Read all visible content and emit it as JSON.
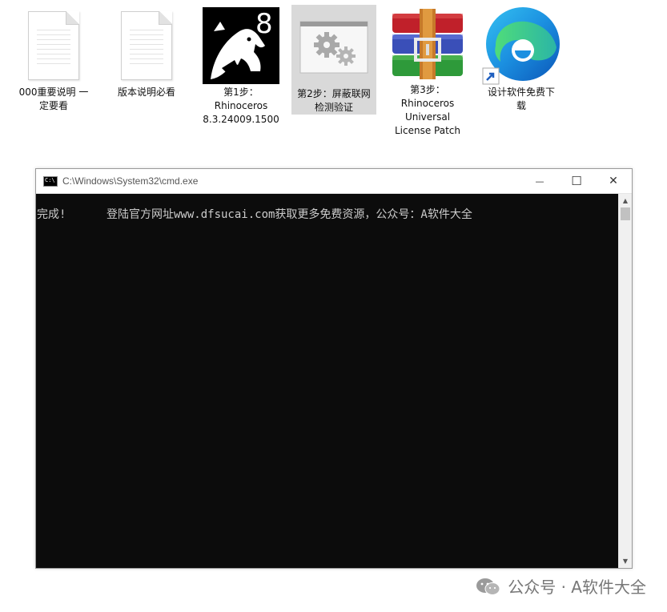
{
  "desktop": {
    "icons": [
      {
        "label": "000重要说明 一\n定要看",
        "icon": "text-document-icon"
      },
      {
        "label": "版本说明必看",
        "icon": "text-document-icon"
      },
      {
        "label": "第1步：\nRhinoceros\n8.3.24009.1500",
        "icon": "rhinoceros-app-icon",
        "badge": "8"
      },
      {
        "label": "第2步：屏蔽联网\n检测验证",
        "icon": "settings-gears-icon"
      },
      {
        "label": "第3步：\nRhinoceros\nUniversal\nLicense Patch",
        "icon": "winrar-archive-icon"
      },
      {
        "label": "设计软件免费下\n载",
        "icon": "edge-browser-shortcut-icon"
      }
    ]
  },
  "cmd_window": {
    "title": "C:\\Windows\\System32\\cmd.exe",
    "minimize": "—",
    "maximize": "☐",
    "close": "✕",
    "output": "完成!      登陆官方网址www.dfsucai.com获取更多免费资源，公众号：A软件大全"
  },
  "watermark": {
    "text": "公众号 · A软件大全"
  },
  "colors": {
    "console_bg": "#0c0c0c",
    "console_text": "#cccccc",
    "selection": "#d9d9d9"
  }
}
